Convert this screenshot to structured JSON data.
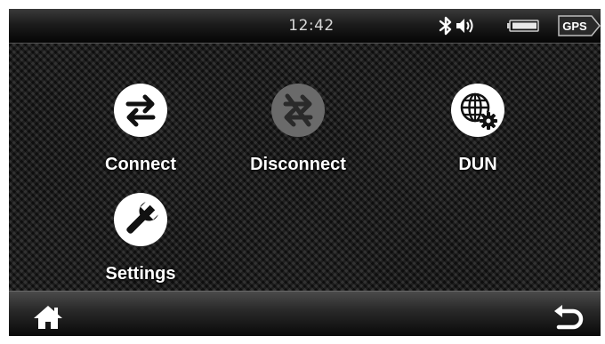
{
  "status_bar": {
    "time": "12:42",
    "gps_label": "GPS",
    "icons": [
      "bluetooth-icon",
      "volume-icon",
      "battery-icon",
      "gps-badge"
    ]
  },
  "apps": [
    {
      "id": "connect",
      "label": "Connect",
      "icon": "connect-icon",
      "enabled": true
    },
    {
      "id": "disconnect",
      "label": "Disconnect",
      "icon": "disconnect-icon",
      "enabled": false
    },
    {
      "id": "dun",
      "label": "DUN",
      "icon": "dun-globe-gear-icon",
      "enabled": true
    },
    {
      "id": "settings",
      "label": "Settings",
      "icon": "wrench-icon",
      "enabled": true
    }
  ],
  "bottom_bar": {
    "home_icon": "home-icon",
    "back_icon": "back-icon"
  },
  "colors": {
    "icon_active_bg": "#ffffff",
    "icon_active_fg": "#111111",
    "icon_disabled_bg": "#6a6a6a",
    "icon_disabled_fg": "#2a2a2a",
    "label": "#ffffff"
  }
}
